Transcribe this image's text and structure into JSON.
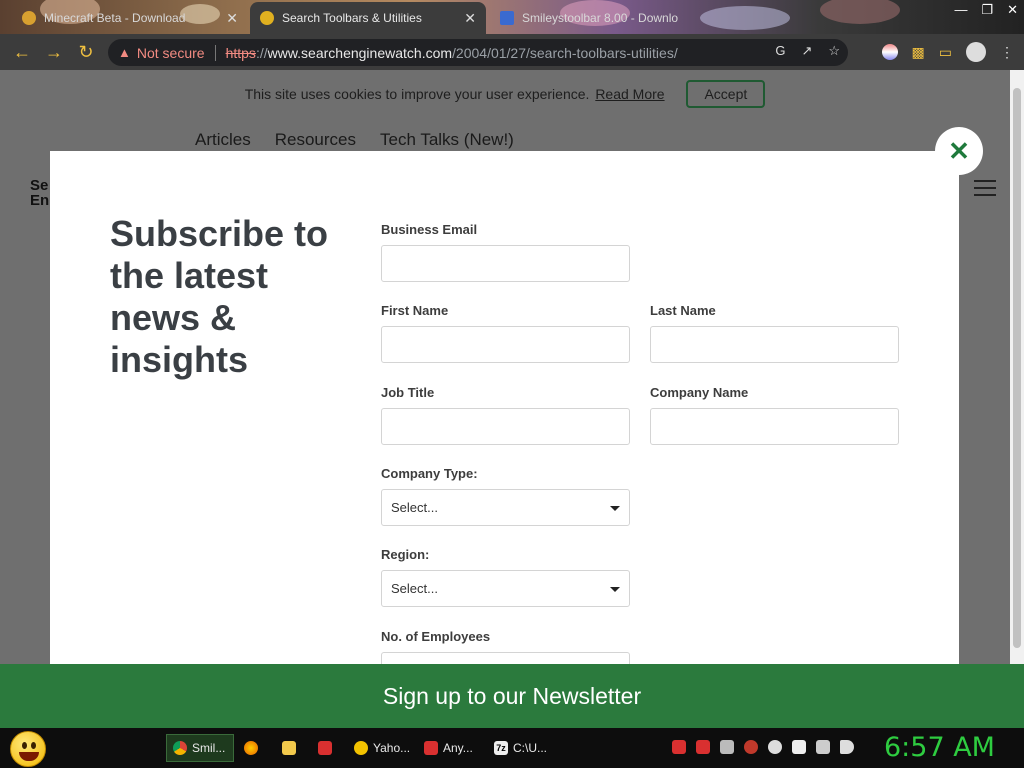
{
  "browser": {
    "tabs": [
      {
        "title": "Minecraft Beta - Download",
        "active": false,
        "favicon_color": "#d8a030"
      },
      {
        "title": "Search Toolbars & Utilities",
        "active": true,
        "favicon_color": "#e0b020"
      },
      {
        "title": "Smileystoolbar 8.00 - Downlo",
        "active": false,
        "favicon_color": "#3a6ad0"
      }
    ],
    "tab_close_glyph": "✕",
    "address_bar": {
      "security_label": "Not secure",
      "scheme": "https",
      "separator": "://",
      "host": "www.searchenginewatch.com",
      "path": "/2004/01/27/search-toolbars-utilities/"
    }
  },
  "site": {
    "cookie_banner": {
      "text": "This site uses cookies to improve your user experience.",
      "link_label": "Read More",
      "accept_label": "Accept"
    },
    "nav_items": [
      "Articles",
      "Resources",
      "Tech Talks (New!)"
    ],
    "logo_fragment_line1": "Se",
    "logo_fragment_line2": "En"
  },
  "modal": {
    "headline": "Subscribe to the latest news & insights",
    "close_glyph": "✕",
    "fields": {
      "business_email": {
        "label": "Business Email",
        "value": ""
      },
      "first_name": {
        "label": "First Name",
        "value": ""
      },
      "last_name": {
        "label": "Last Name",
        "value": ""
      },
      "job_title": {
        "label": "Job Title",
        "value": ""
      },
      "company_name": {
        "label": "Company Name",
        "value": ""
      },
      "company_type": {
        "label": "Company Type:",
        "selected": "Select..."
      },
      "region": {
        "label": "Region:",
        "selected": "Select..."
      },
      "employees": {
        "label": "No. of Employees"
      }
    }
  },
  "newsletter_banner": {
    "label": "Sign up to our Newsletter",
    "color": "#2b7a3d"
  },
  "taskbar": {
    "items": [
      {
        "label": "Smil...",
        "icon": "chrome-icon",
        "active": true
      },
      {
        "label": "",
        "icon": "firefox-icon",
        "active": false
      },
      {
        "label": "",
        "icon": "folder-icon",
        "active": false
      },
      {
        "label": "",
        "icon": "anymp4-icon",
        "active": false
      },
      {
        "label": "Yaho...",
        "icon": "smiley-icon",
        "active": false
      },
      {
        "label": "Any...",
        "icon": "anymp4-icon",
        "active": false
      },
      {
        "label": "C:\\U...",
        "icon": "7zip-icon",
        "active": false
      }
    ],
    "clock": "6:57 AM",
    "clock_color": "#2ecc40"
  }
}
